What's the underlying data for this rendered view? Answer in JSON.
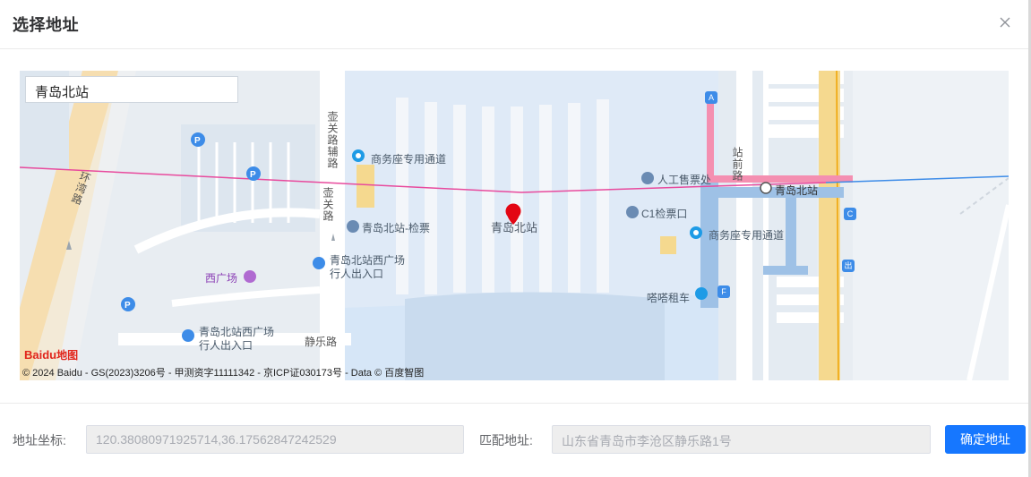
{
  "dialog": {
    "title": "选择地址",
    "close_icon": "close-icon"
  },
  "map": {
    "search_value": "青岛北站",
    "labels": {
      "business_seat_1": "商务座专用通道",
      "business_seat_2": "商务座专用通道",
      "manual_ticket": "人工售票处",
      "qingdao_north_station_metro": "青岛北站",
      "qingdao_north_check": "青岛北站-检票",
      "qingdao_north_center": "青岛北站",
      "c1_gate": "C1检票口",
      "west_square_entrance_line1": "青岛北站西广场",
      "west_square_entrance_line2": "行人出入口",
      "west_square": "西广场",
      "west_square_exit_line1": "青岛北站西广场",
      "west_square_exit_line2": "行人出入口",
      "dada_taxi": "嗒嗒租车",
      "jingle_road": "静乐路",
      "huguan_aux_road": "壶关路辅路",
      "huguan_road": "壶关路",
      "zhanqian_road": "站前路",
      "ring_expressway": "环湾路",
      "gate_a": "A",
      "gate_c": "C",
      "gate_f": "F",
      "exit_mark": "出"
    },
    "logo": {
      "text": "Baidu",
      "suffix": "地图"
    },
    "copyright": "© 2024 Baidu - GS(2023)3206号 - 甲测资字11111342 - 京ICP证030173号 - Data © 百度智图"
  },
  "form": {
    "coord_label": "地址坐标:",
    "coord_value": "120.38080971925714,36.17562847242529",
    "match_label": "匹配地址:",
    "match_value": "山东省青岛市李沧区静乐路1号",
    "confirm_label": "确定地址"
  },
  "colors": {
    "primary": "#1677ff",
    "map_background": "#e9eef3",
    "marker_red": "#e30613"
  }
}
